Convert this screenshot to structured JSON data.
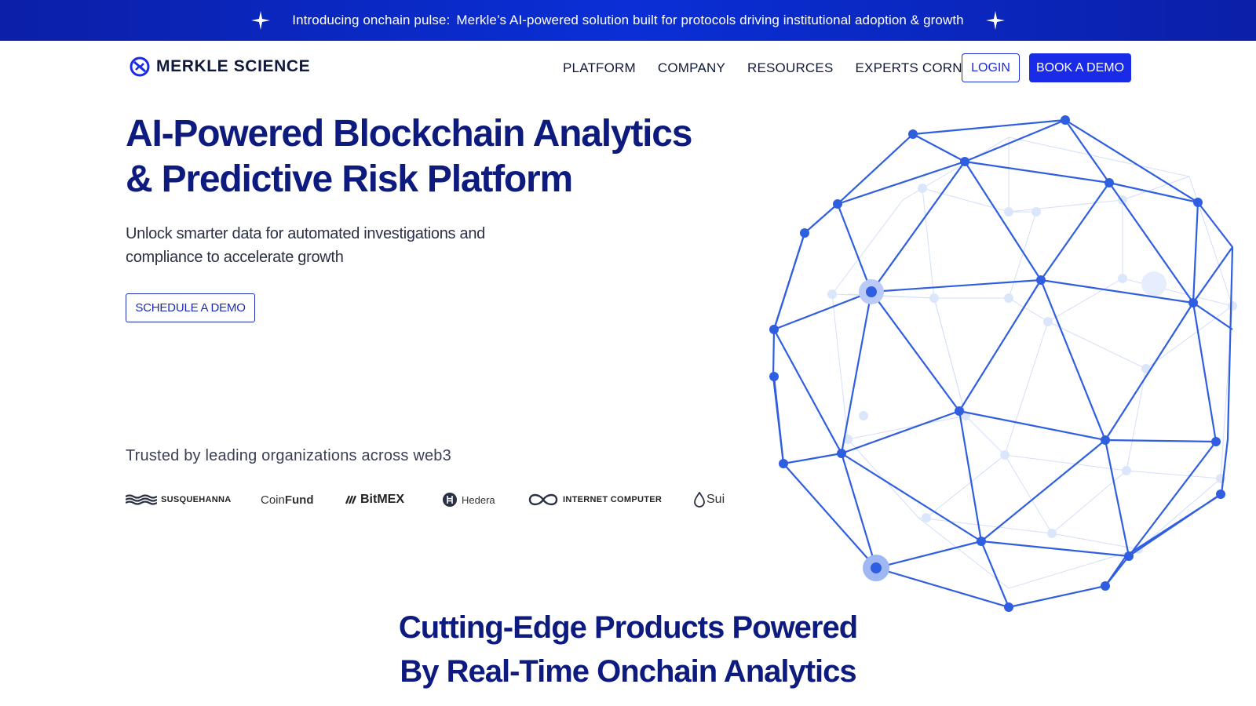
{
  "announcement": {
    "lead": "Introducing onchain pulse:",
    "text": "Merkle’s AI-powered solution built for protocols driving institutional adoption & growth"
  },
  "brand": {
    "name": "MERKLE SCIENCE"
  },
  "nav": {
    "items": [
      {
        "label": "PLATFORM"
      },
      {
        "label": "COMPANY"
      },
      {
        "label": "RESOURCES"
      },
      {
        "label": "EXPERTS CORNER"
      }
    ],
    "login_label": "LOGIN",
    "demo_label": "BOOK A DEMO"
  },
  "hero": {
    "title_line1": "AI-Powered Blockchain Analytics",
    "title_line2": "& Predictive Risk Platform",
    "subtitle_line1": "Unlock smarter data for automated investigations and",
    "subtitle_line2": "compliance to accelerate growth",
    "cta_label": "SCHEDULE A DEMO"
  },
  "trusted": {
    "heading": "Trusted by leading organizations across web3",
    "partners": [
      {
        "name": "SUSQUEHANNA",
        "icon": "waves-icon"
      },
      {
        "name_a": "Coin",
        "name_b": "Fund"
      },
      {
        "name_a": "BitMEX"
      },
      {
        "name_a": "Hedera",
        "icon": "hedera-icon"
      },
      {
        "name": "INTERNET COMPUTER",
        "icon": "infinity-icon"
      },
      {
        "name_a": "Sui",
        "icon": "sui-drop-icon"
      }
    ]
  },
  "section": {
    "title_line1": "Cutting-Edge Products Powered",
    "title_line2": "By Real-Time Onchain Analytics"
  },
  "colors": {
    "brand_blue": "#1a2be8",
    "heading_navy": "#0d1a7e",
    "globe_blue": "#2f5fe0"
  }
}
